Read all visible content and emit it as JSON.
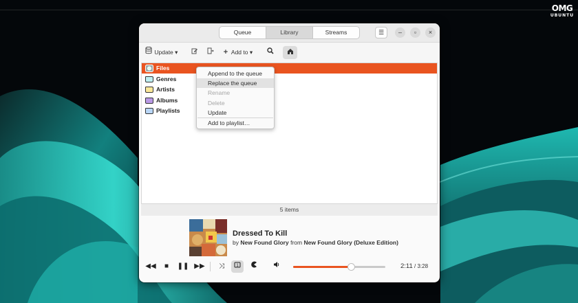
{
  "watermark": {
    "big": "OMG",
    "small": "UBUNTU"
  },
  "colors": {
    "accent": "#e95420",
    "desktop_teal": "#1fb8b0",
    "window_bg": "#fafafa"
  },
  "titlebar": {
    "tabs": [
      {
        "label": "Queue",
        "active": false
      },
      {
        "label": "Library",
        "active": true
      },
      {
        "label": "Streams",
        "active": false
      }
    ],
    "menu_icon": "hamburger-icon",
    "controls": {
      "minimize": "–",
      "maximize": "▫",
      "close": "×"
    }
  },
  "toolbar": {
    "update_label": "Update ▾",
    "add_to_label": "Add to ▾",
    "icons": [
      "database-icon",
      "edit-icon",
      "delete-icon",
      "plus-icon",
      "search-icon",
      "home-icon"
    ]
  },
  "library": {
    "items": [
      {
        "label": "Files",
        "icon": "disk-icon",
        "selected": true
      },
      {
        "label": "Genres",
        "icon": "folder-teal-icon",
        "selected": false
      },
      {
        "label": "Artists",
        "icon": "folder-yellow-icon",
        "selected": false
      },
      {
        "label": "Albums",
        "icon": "folder-purple-icon",
        "selected": false
      },
      {
        "label": "Playlists",
        "icon": "folder-blue-icon",
        "selected": false
      }
    ],
    "status": "5 items"
  },
  "context_menu": {
    "items": [
      {
        "label": "Append to the queue",
        "state": "normal"
      },
      {
        "label": "Replace the queue",
        "state": "hover"
      },
      {
        "label": "Rename",
        "state": "disabled"
      },
      {
        "label": "Delete",
        "state": "disabled"
      },
      {
        "label": "Update",
        "state": "normal"
      },
      {
        "label": "Add to playlist…",
        "state": "normal"
      }
    ]
  },
  "now_playing": {
    "title": "Dressed To Kill",
    "by_prefix": "by",
    "artist": "New Found Glory",
    "from_prefix": "from",
    "album": "New Found Glory (Deluxe Edition)"
  },
  "playback": {
    "elapsed": "2:11",
    "total": "3:28",
    "progress_fraction": 0.63,
    "icons": [
      "previous-icon",
      "stop-icon",
      "pause-icon",
      "next-icon",
      "shuffle-icon",
      "repeat-one-icon",
      "consume-icon",
      "volume-icon"
    ]
  }
}
